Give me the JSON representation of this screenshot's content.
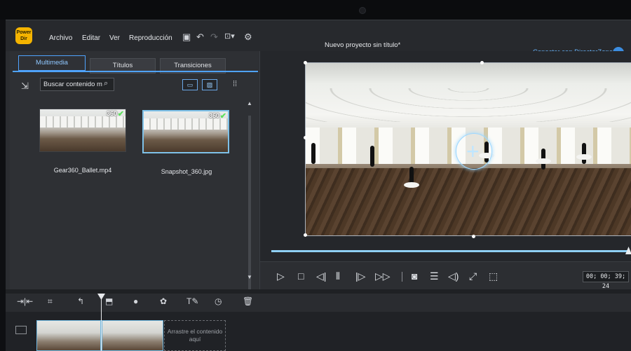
{
  "app": {
    "logo_text": "Power Dir",
    "project_title": "Nuevo proyecto sin título*",
    "connect_link": "Conectar con DirectorZone"
  },
  "menu": {
    "items": [
      "Archivo",
      "Editar",
      "Ver",
      "Reproducción"
    ]
  },
  "library": {
    "tabs": [
      "Multimedia",
      "Títulos",
      "Transiciones"
    ],
    "active_tab": "Multimedia",
    "search_value": "Buscar contenido m",
    "items": [
      {
        "label": "Gear360_Ballet.mp4",
        "badge": "360",
        "selected": false
      },
      {
        "label": "Snapshot_360.jpg",
        "badge": "360",
        "selected": true
      }
    ]
  },
  "player": {
    "timecode": "00; 00; 39; 24",
    "progress": 0.99
  },
  "timeline": {
    "dropzone_text": "Arrastre el contenido aquí"
  },
  "icons": {
    "toolbar": [
      "save-icon",
      "undo-icon",
      "redo-icon",
      "aspect-ratio-icon",
      "settings-icon"
    ],
    "player": [
      "play-icon",
      "stop-icon",
      "prev-frame-icon",
      "split-icon",
      "next-frame-icon",
      "fast-forward-icon",
      "snapshot-icon",
      "subtitles-icon",
      "volume-icon",
      "fullscreen-icon",
      "undock-icon"
    ]
  },
  "colors": {
    "accent": "#4fa3ff",
    "link": "#6ab7ff",
    "logo": "#f5b400"
  }
}
